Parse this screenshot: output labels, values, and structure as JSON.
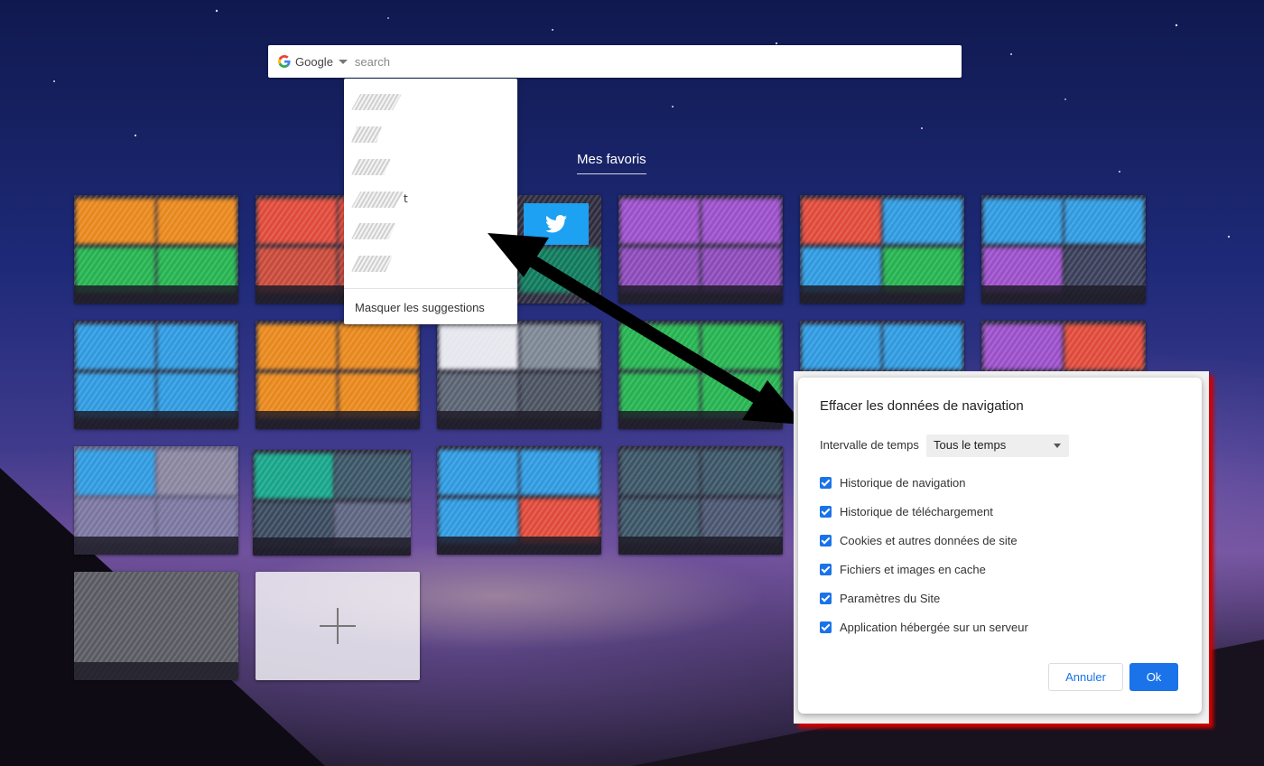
{
  "search": {
    "engine_label": "Google",
    "placeholder": "search",
    "suggestions": [
      {
        "tail": ""
      },
      {
        "tail": ""
      },
      {
        "tail": ""
      },
      {
        "tail": "t"
      },
      {
        "tail": ""
      },
      {
        "tail": ""
      }
    ],
    "hide_suggestions_label": "Masquer les suggestions"
  },
  "favorites": {
    "title": "Mes favoris",
    "add_icon": "plus-icon"
  },
  "dialog": {
    "title": "Effacer les données de navigation",
    "range_label": "Intervalle de temps",
    "range_value": "Tous le temps",
    "options": [
      {
        "label": "Historique de navigation",
        "checked": true
      },
      {
        "label": "Historique de téléchargement",
        "checked": true
      },
      {
        "label": "Cookies et autres données de site",
        "checked": true
      },
      {
        "label": "Fichiers et images en cache",
        "checked": true
      },
      {
        "label": "Paramètres du Site",
        "checked": true
      },
      {
        "label": "Application hébergée sur un serveur",
        "checked": true
      }
    ],
    "cancel_label": "Annuler",
    "ok_label": "Ok"
  },
  "colors": {
    "accent": "#1a73e8",
    "highlight": "#d10000",
    "twitter": "#1da1f2"
  }
}
